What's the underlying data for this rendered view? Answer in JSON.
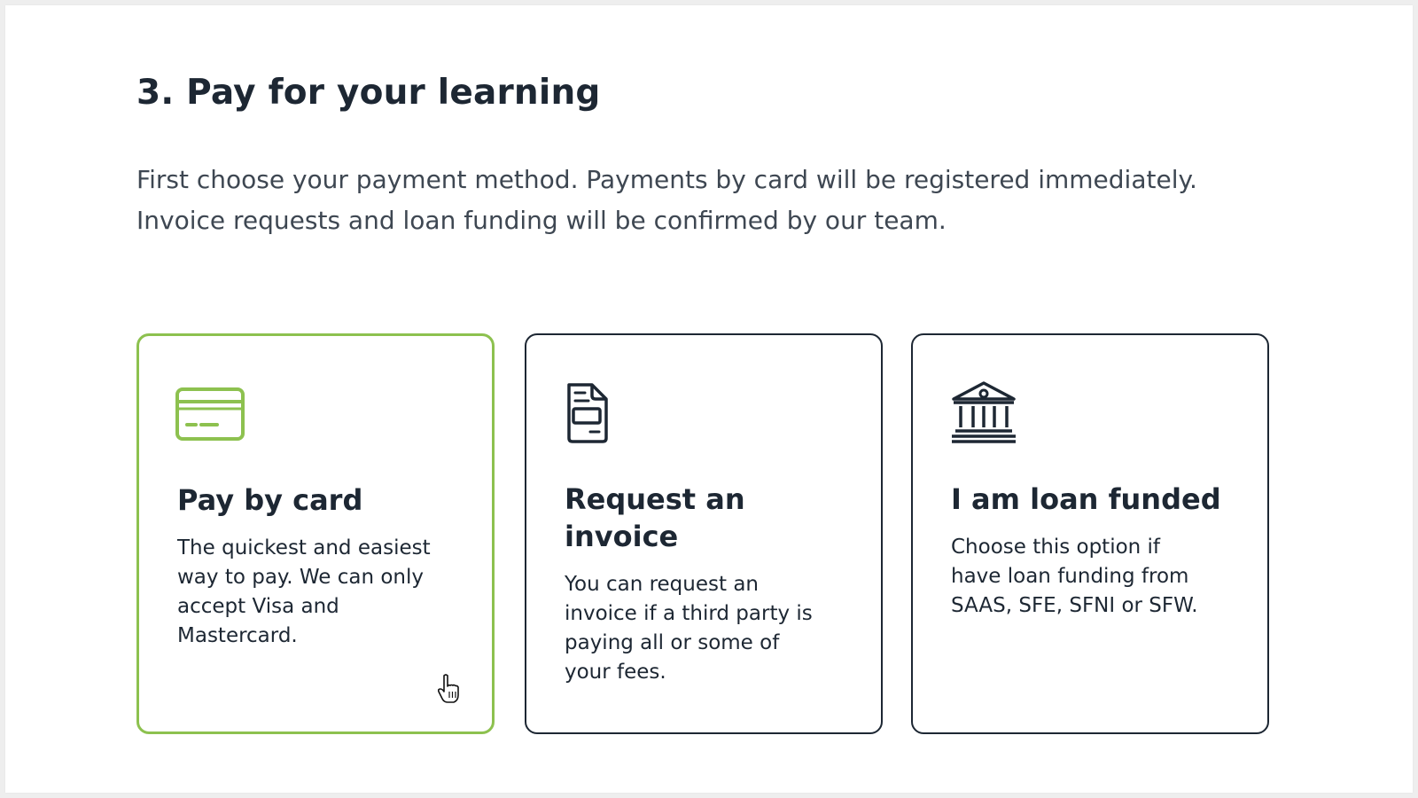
{
  "section": {
    "title": "3. Pay for your learning",
    "intro_lines": [
      "First choose your payment method. Payments by card will be registered immediately.",
      "Invoice requests and loan funding will be confirmed by our team."
    ]
  },
  "payment_options": [
    {
      "icon": "credit-card-icon",
      "title": "Pay by card",
      "description_lines": [
        "The quickest and easiest",
        "way to pay. We can only",
        "accept Visa and",
        "Mastercard."
      ],
      "state": "selected"
    },
    {
      "icon": "invoice-document-icon",
      "title": "Request an invoice",
      "description_lines": [
        "You can request an",
        "invoice if a third party is",
        "paying all or some of",
        "your fees."
      ],
      "state": "default"
    },
    {
      "icon": "bank-building-icon",
      "title": "I am loan funded",
      "description_lines": [
        "Choose this option if",
        "have loan funding from",
        "SAAS, SFE, SFNI or SFW."
      ],
      "state": "default"
    }
  ],
  "colors": {
    "selected_accent": "#8dc14f",
    "text_dark": "#1d2733",
    "text_body": "#3e4752",
    "card_border": "#1d2733"
  }
}
